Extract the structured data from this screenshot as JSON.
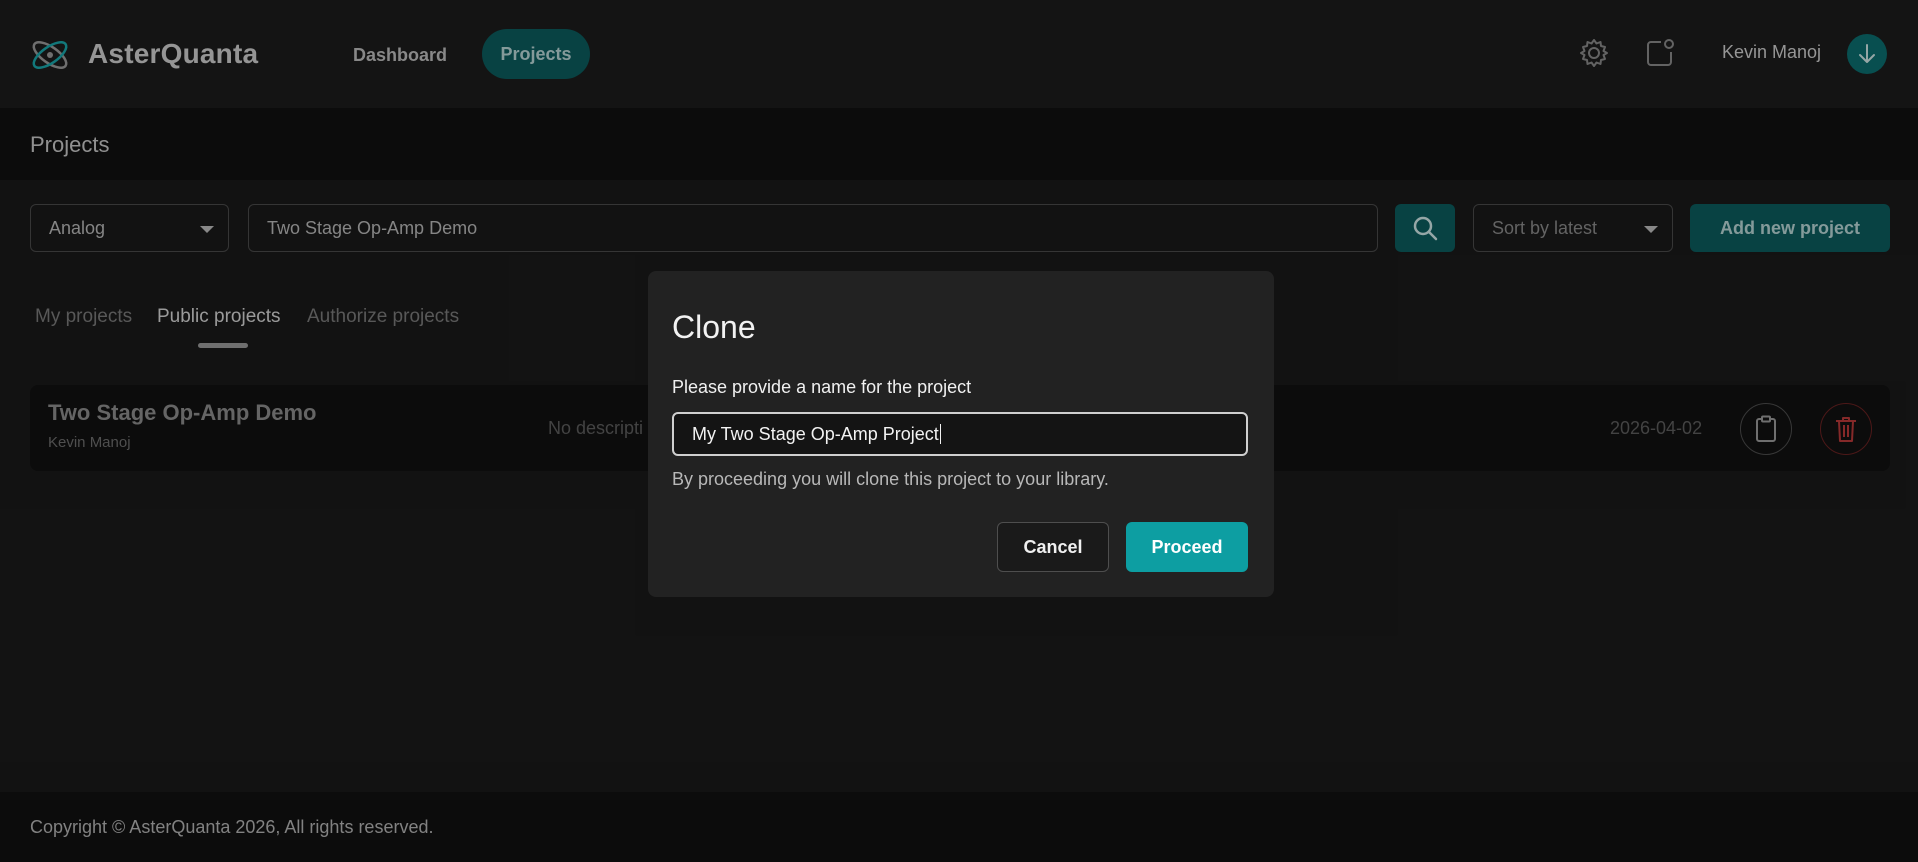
{
  "app": {
    "name": "AsterQuanta"
  },
  "nav": {
    "dashboard": "Dashboard",
    "projects": "Projects"
  },
  "header": {
    "user_name": "Kevin Manoj",
    "icons": [
      "gear-icon",
      "notification-icon",
      "download-icon"
    ]
  },
  "page": {
    "title": "Projects"
  },
  "filters": {
    "type_selected": "Analog",
    "search_value": "Two Stage Op-Amp Demo",
    "sort_selected": "Sort by latest",
    "add_label": "Add new project"
  },
  "tabs": [
    {
      "label": "My projects",
      "active": false
    },
    {
      "label": "Public projects",
      "active": true
    },
    {
      "label": "Authorize projects",
      "active": false
    }
  ],
  "project": {
    "name": "Two Stage Op-Amp Demo",
    "owner": "Kevin Manoj",
    "description": "No descripti",
    "date": "2026-04-02"
  },
  "modal": {
    "title": "Clone",
    "label": "Please provide a name for the project",
    "input_value": "My Two Stage Op-Amp Project",
    "help": "By proceeding you will clone this project to your library.",
    "cancel": "Cancel",
    "proceed": "Proceed"
  },
  "footer": {
    "copyright": "Copyright © AsterQuanta 2026, All rights reserved."
  },
  "colors": {
    "accent": "#0c5c5e",
    "proceed": "#0d9ea2",
    "danger": "#b93a3a",
    "background": "#1a1a1a"
  }
}
